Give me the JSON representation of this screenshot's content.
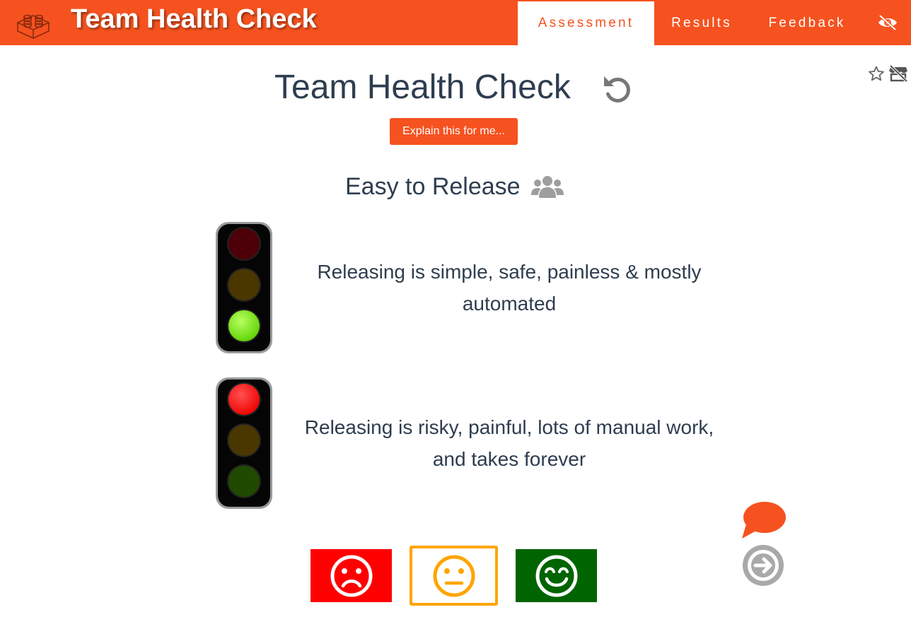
{
  "header": {
    "title": "Team Health Check",
    "brand_color": "#f5521f",
    "tabs": [
      {
        "label": "Assessment",
        "active": true
      },
      {
        "label": "Results",
        "active": false
      },
      {
        "label": "Feedback",
        "active": false
      }
    ],
    "icons": [
      "lego-brick-icon",
      "eye-slash-icon"
    ]
  },
  "toolbar_icons": [
    "star-icon",
    "store-slash-icon"
  ],
  "main": {
    "title": "Team Health Check",
    "reset_icon": "undo-icon",
    "explain_label": "Explain this for me...",
    "topic": {
      "name": "Easy to Release",
      "icon": "users-icon",
      "good_description": "Releasing is simple, safe, painless & mostly automated",
      "bad_description": "Releasing is risky, painful, lots of manual work, and takes forever"
    },
    "votes": [
      {
        "name": "red",
        "icon": "sad-face-icon",
        "color": "#ff0000",
        "selected": false
      },
      {
        "name": "amber",
        "icon": "neutral-face-icon",
        "color": "#ffa500",
        "selected": true
      },
      {
        "name": "green",
        "icon": "happy-face-icon",
        "color": "#006400",
        "selected": false
      }
    ]
  },
  "side_actions": [
    "comment-icon",
    "next-arrow-icon"
  ]
}
